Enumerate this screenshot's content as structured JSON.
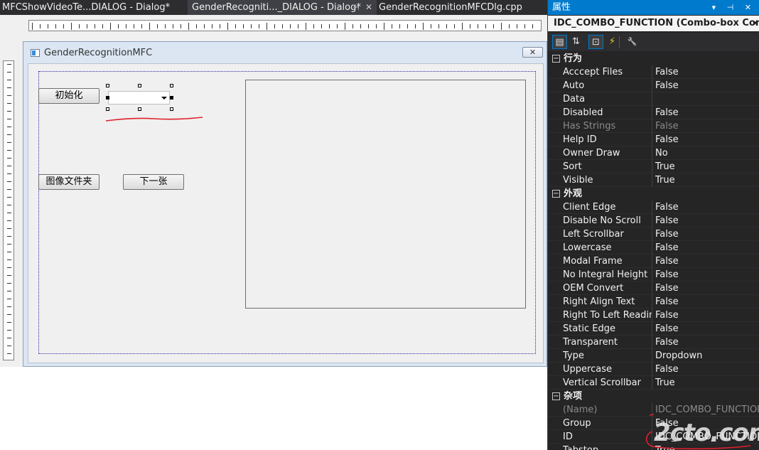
{
  "tabs": [
    {
      "label": "MFCShowVideoTe...DIALOG - Dialog*"
    },
    {
      "label": "GenderRecogniti..._DIALOG - Dialog*",
      "pin": "⊣",
      "close": "✕"
    },
    {
      "label": "GenderRecognitionMFCDlg.cpp"
    }
  ],
  "dialog": {
    "title": "GenderRecognitionMFC",
    "close_glyph": "✕",
    "buttons": {
      "init": "初始化",
      "image_folder": "图像文件夹",
      "next": "下一张"
    }
  },
  "properties": {
    "panel_title": "属性",
    "title_tools": "▾ ⊣ ✕",
    "object": "IDC_COMBO_FUNCTION (Combo-box Control",
    "object_arrow": "▾",
    "toolbar": [
      {
        "icon": "categorized-icon",
        "glyph": "▤"
      },
      {
        "icon": "alphabetical-icon",
        "glyph": "⇅"
      },
      {
        "icon": "properties-icon",
        "glyph": "⊡"
      },
      {
        "icon": "events-icon",
        "glyph": "⚡"
      },
      {
        "icon": "wrench-icon",
        "glyph": "🔧"
      }
    ],
    "toggle_glyph": "−",
    "categories": [
      {
        "name": "行为",
        "rows": [
          {
            "name": "Acccept Files",
            "value": "False"
          },
          {
            "name": "Auto",
            "value": "False"
          },
          {
            "name": "Data",
            "value": ""
          },
          {
            "name": "Disabled",
            "value": "False"
          },
          {
            "name": "Has Strings",
            "value": "False",
            "dim": true
          },
          {
            "name": "Help ID",
            "value": "False"
          },
          {
            "name": "Owner Draw",
            "value": "No"
          },
          {
            "name": "Sort",
            "value": "True"
          },
          {
            "name": "Visible",
            "value": "True"
          }
        ]
      },
      {
        "name": "外观",
        "rows": [
          {
            "name": "Client Edge",
            "value": "False"
          },
          {
            "name": "Disable No Scroll",
            "value": "False"
          },
          {
            "name": "Left Scrollbar",
            "value": "False"
          },
          {
            "name": "Lowercase",
            "value": "False"
          },
          {
            "name": "Modal Frame",
            "value": "False"
          },
          {
            "name": "No Integral Height",
            "value": "False"
          },
          {
            "name": "OEM Convert",
            "value": "False"
          },
          {
            "name": "Right Align Text",
            "value": "False"
          },
          {
            "name": "Right To Left Reading",
            "value": "False"
          },
          {
            "name": "Static Edge",
            "value": "False"
          },
          {
            "name": "Transparent",
            "value": "False"
          },
          {
            "name": "Type",
            "value": "Dropdown"
          },
          {
            "name": "Uppercase",
            "value": "False"
          },
          {
            "name": "Vertical Scrollbar",
            "value": "True"
          }
        ]
      },
      {
        "name": "杂项",
        "rows": [
          {
            "name": "(Name)",
            "value": "IDC_COMBO_FUNCTION",
            "dim": true
          },
          {
            "name": "Group",
            "value": "False"
          },
          {
            "name": "ID",
            "value": "IDC_COMBO_FUNCTION"
          },
          {
            "name": "Tabstop",
            "value": "True"
          }
        ]
      }
    ]
  },
  "watermark": "2cto.com",
  "colors": {
    "accent": "#007acc",
    "annotation": "#e0202a",
    "panel_bg": "#252526"
  }
}
